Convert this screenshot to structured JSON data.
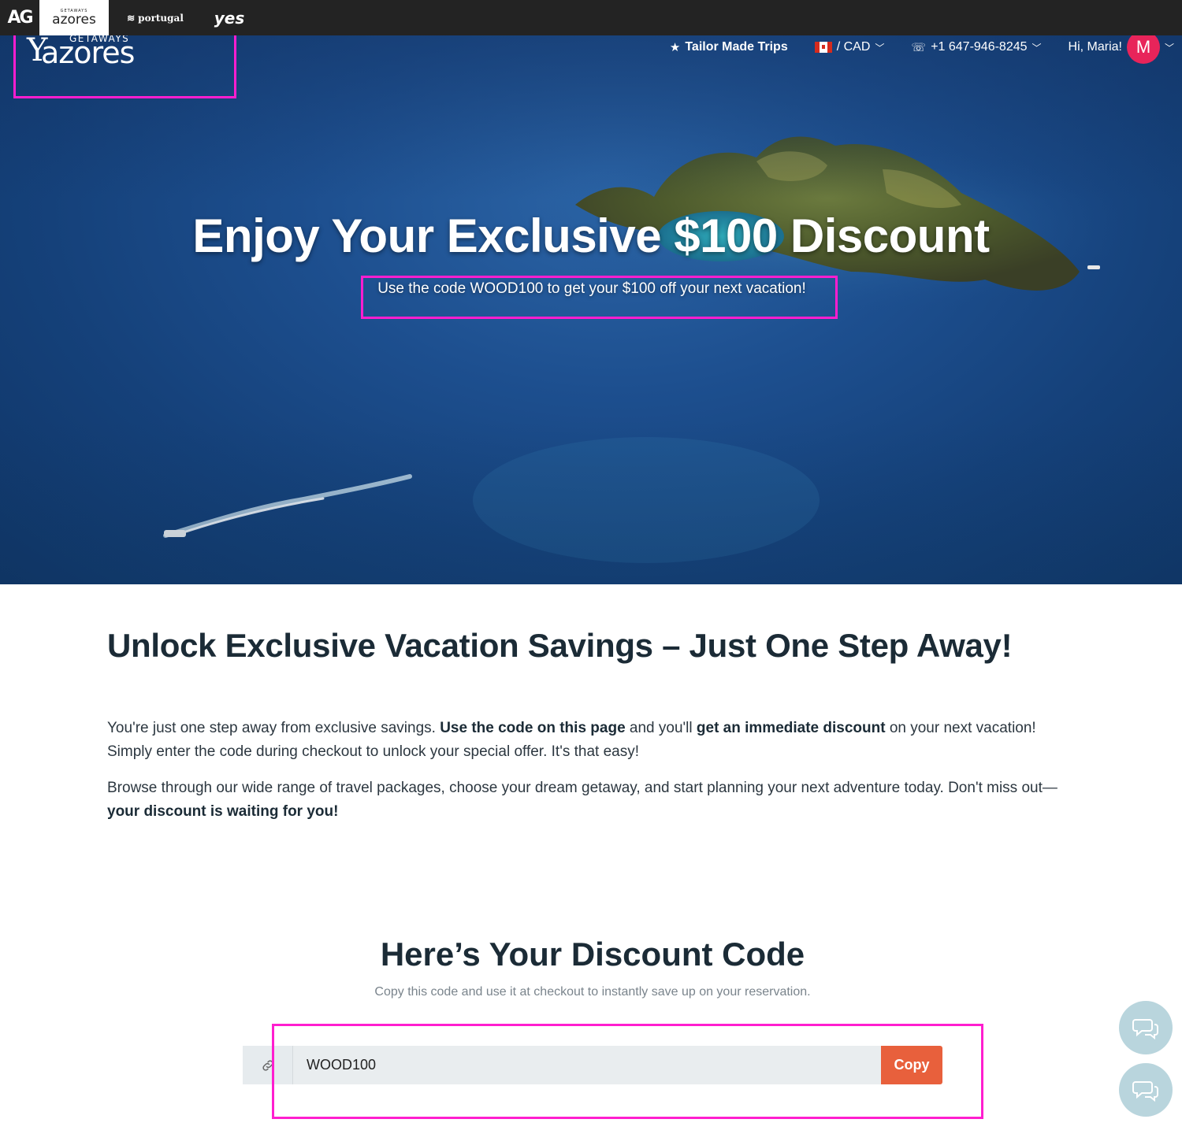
{
  "brand_bar": {
    "tabs": [
      {
        "label": "AG"
      },
      {
        "label": "azores",
        "sub": "GETAWAYS"
      },
      {
        "label": "portugal"
      },
      {
        "label": "yes"
      }
    ]
  },
  "header": {
    "logo_sub": "GETAWAYS",
    "logo_main": "azores",
    "tailor_made": "Tailor Made Trips",
    "currency": "/ CAD",
    "phone": "+1 647-946-8245",
    "greeting": "Hi, Maria!",
    "avatar_letter": "M"
  },
  "hero": {
    "title": "Enjoy Your Exclusive $100 Discount",
    "subtitle": "Use the code WOOD100 to get your $100 off your next vacation!"
  },
  "content": {
    "heading": "Unlock Exclusive Vacation Savings – Just One Step Away!",
    "p1_a": "You're just one step away from exclusive savings. ",
    "p1_b": "Use the code on this page",
    "p1_c": " and you'll ",
    "p1_d": "get an immediate discount",
    "p1_e": " on your next vacation! Simply enter the code during checkout to unlock your special offer. It's that easy!",
    "p2_a": "Browse through our wide range of travel packages, choose your dream getaway, and start planning your next adventure today. Don't miss out—",
    "p2_b": "your discount is waiting for you!"
  },
  "discount": {
    "heading": "Here’s Your Discount Code",
    "subtext": "Copy this code and use it at checkout to instantly save up on your reservation.",
    "code": "WOOD100",
    "copy_label": "Copy"
  },
  "icons": {
    "link": "link-icon",
    "chat": "chat-icon",
    "star": "star-icon",
    "phone": "phone-icon",
    "chevron": "chevron-down-icon"
  },
  "colors": {
    "highlight": "#ff1ecf",
    "copy_button": "#e8603c",
    "avatar": "#e8245a",
    "chat_button": "#b9d5dd",
    "brand_bar": "#232323"
  }
}
